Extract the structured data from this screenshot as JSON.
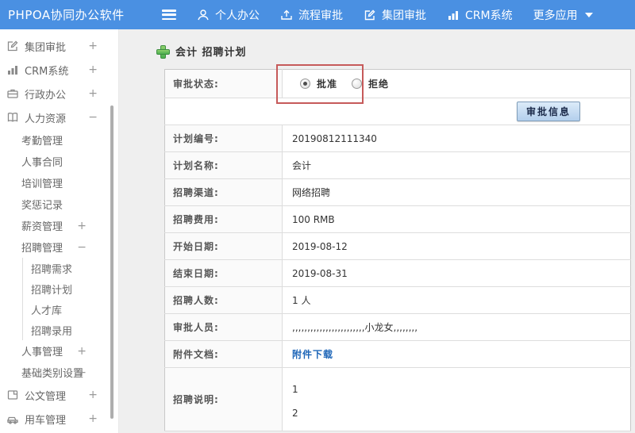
{
  "colors": {
    "accent": "#4a90e2",
    "link": "#1e66b8",
    "highlight": "#c65a5a",
    "btn-bg": "#c9ddf2",
    "btn-border": "#7f9db9",
    "plus-green": "#4caf50"
  },
  "topbar": {
    "brand": "PHPOA协同办公软件",
    "items": [
      {
        "label": "个人办公",
        "icon": "person-icon"
      },
      {
        "label": "流程审批",
        "icon": "flow-approval-icon"
      },
      {
        "label": "集团审批",
        "icon": "edit-icon"
      },
      {
        "label": "CRM系统",
        "icon": "bar-chart-icon"
      },
      {
        "label": "更多应用",
        "icon": "caret-down-icon"
      }
    ]
  },
  "sidebar": {
    "items": [
      {
        "label": "集团审批",
        "icon": "edit-icon",
        "expand": "+"
      },
      {
        "label": "CRM系统",
        "icon": "bar-chart-icon",
        "expand": "+"
      },
      {
        "label": "行政办公",
        "icon": "briefcase-icon",
        "expand": "+"
      },
      {
        "label": "人力资源",
        "icon": "book-icon",
        "expand": "−"
      },
      {
        "label": "考勤管理",
        "expand": ""
      },
      {
        "label": "人事合同",
        "expand": ""
      },
      {
        "label": "培训管理",
        "expand": ""
      },
      {
        "label": "奖惩记录",
        "expand": ""
      },
      {
        "label": "薪资管理",
        "expand": "+"
      },
      {
        "label": "招聘管理",
        "expand": "−"
      },
      {
        "label": "招聘需求",
        "expand": ""
      },
      {
        "label": "招聘计划",
        "expand": ""
      },
      {
        "label": "人才库",
        "expand": ""
      },
      {
        "label": "招聘录用",
        "expand": ""
      },
      {
        "label": "人事管理",
        "expand": "+"
      },
      {
        "label": "基础类别设置",
        "expand": "+"
      },
      {
        "label": "公文管理",
        "icon": "document-icon",
        "expand": "+"
      },
      {
        "label": "用车管理",
        "icon": "car-icon",
        "expand": "+"
      }
    ]
  },
  "main": {
    "title": "会计 招聘计划",
    "approval": {
      "label": "审批状态:",
      "options": [
        {
          "label": "批准",
          "checked": true
        },
        {
          "label": "拒绝",
          "checked": false
        }
      ]
    },
    "approve_info_button": "审批信息",
    "rows": [
      {
        "label": "计划编号:",
        "value": "20190812111340"
      },
      {
        "label": "计划名称:",
        "value": "会计"
      },
      {
        "label": "招聘渠道:",
        "value": "网络招聘"
      },
      {
        "label": "招聘费用:",
        "value": "100 RMB"
      },
      {
        "label": "开始日期:",
        "value": "2019-08-12"
      },
      {
        "label": "结束日期:",
        "value": "2019-08-31"
      },
      {
        "label": "招聘人数:",
        "value": "1 人"
      },
      {
        "label": "审批人员:",
        "value": ",,,,,,,,,,,,,,,,,,,,,,,,小龙女,,,,,,,,"
      },
      {
        "label": "附件文档:",
        "value": "附件下载",
        "link": true
      }
    ],
    "description_row": {
      "label": "招聘说明:",
      "lines": [
        "1",
        "2"
      ]
    }
  }
}
